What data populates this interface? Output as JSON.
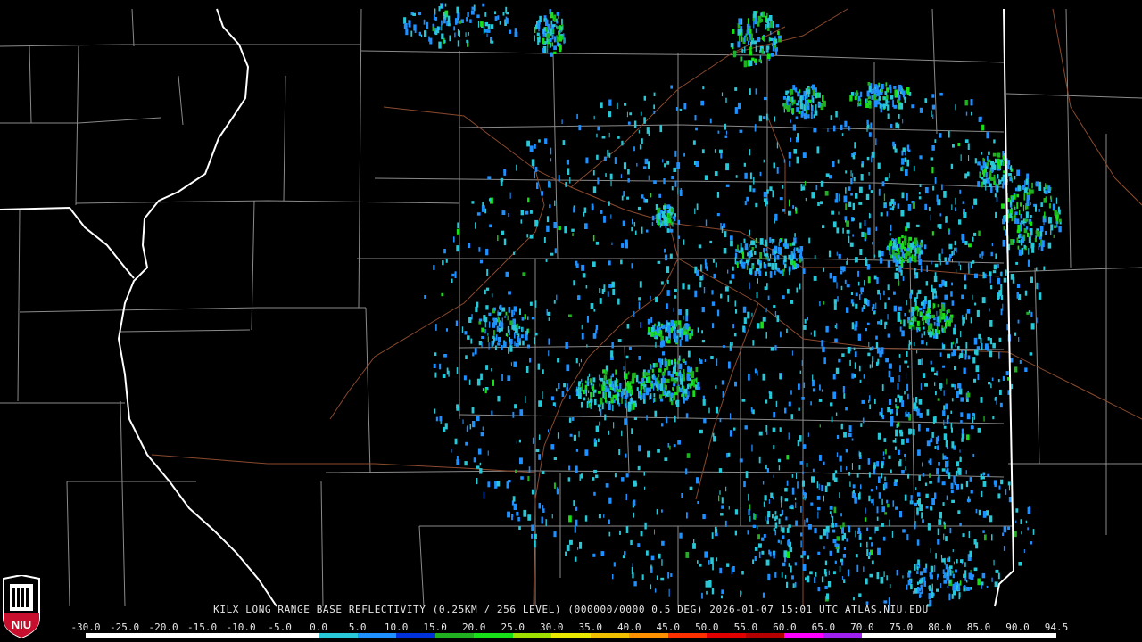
{
  "product": {
    "title": "KILX LONG RANGE BASE REFLECTIVITY (0.25KM / 256 LEVEL) (000000/0000 0.5 DEG) 2026-01-07 15:01 UTC  ATLAS.NIU.EDU"
  },
  "logo": {
    "text": "NIU"
  },
  "legend": {
    "ticks": [
      "-30.0",
      "-25.0",
      "-20.0",
      "-15.0",
      "-10.0",
      "-5.0",
      "0.0",
      "5.0",
      "10.0",
      "15.0",
      "20.0",
      "25.0",
      "30.0",
      "35.0",
      "40.0",
      "45.0",
      "50.0",
      "55.0",
      "60.0",
      "65.0",
      "70.0",
      "75.0",
      "80.0",
      "85.0",
      "90.0",
      "94.5"
    ],
    "colors": [
      "#ffffff",
      "#ffffff",
      "#ffffff",
      "#ffffff",
      "#ffffff",
      "#ffffff",
      "#28c8d8",
      "#1e90ff",
      "#0032dc",
      "#20b020",
      "#18e018",
      "#a0e000",
      "#e8e800",
      "#f0c000",
      "#ff9000",
      "#ff3000",
      "#e00000",
      "#b40000",
      "#ff00ff",
      "#a020f0",
      "#ffffff",
      "#ffffff",
      "#ffffff",
      "#ffffff",
      "#ffffff"
    ]
  },
  "map": {
    "background": "#000000",
    "state_border_color": "#ffffff",
    "county_border_color": "#8a8a8a",
    "highway_color": "#8b4a2e",
    "echo_colors": [
      "#28c8d8",
      "#1e90ff",
      "#0032dc",
      "#20b020",
      "#18e018",
      "#e8e800"
    ]
  }
}
